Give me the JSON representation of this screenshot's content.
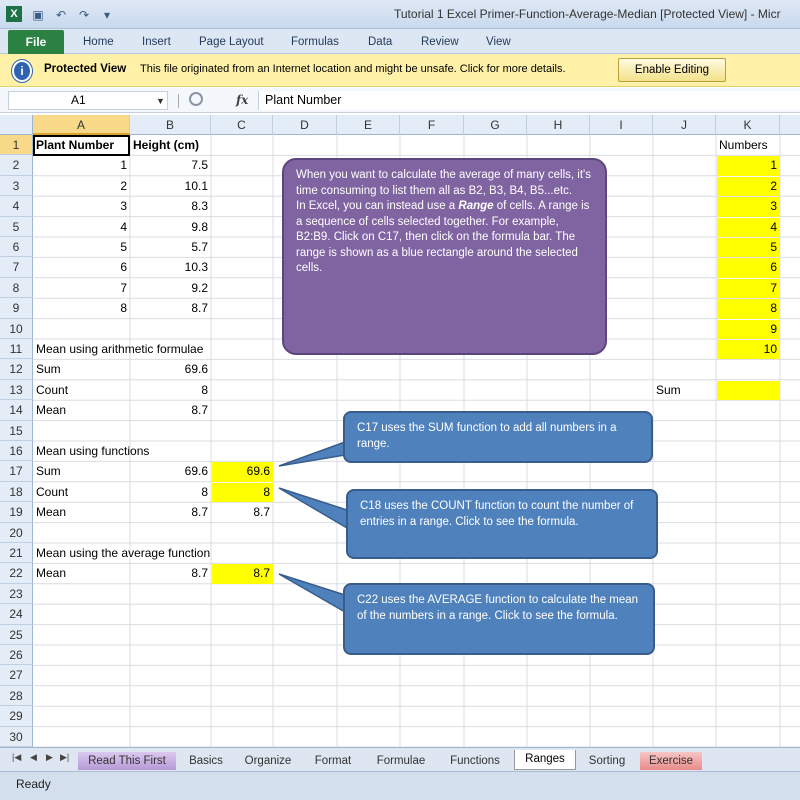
{
  "window": {
    "title": "Tutorial 1 Excel Primer-Function-Average-Median  [Protected View] - Micr",
    "app_icon": "excel-icon",
    "quick_access": [
      "save-icon",
      "undo-icon",
      "redo-icon",
      "customize-icon"
    ]
  },
  "ribbon": {
    "file_label": "File",
    "tabs": [
      "Home",
      "Insert",
      "Page Layout",
      "Formulas",
      "Data",
      "Review",
      "View"
    ]
  },
  "protected_view": {
    "title": "Protected View",
    "message": "This file originated from an Internet location and might be unsafe. Click for more details.",
    "button": "Enable Editing"
  },
  "formula_bar": {
    "name_box": "A1",
    "fx": "fx",
    "content": "Plant Number"
  },
  "columns": [
    "A",
    "B",
    "C",
    "D",
    "E",
    "F",
    "G",
    "H",
    "I",
    "J",
    "K"
  ],
  "rows": [
    "1",
    "2",
    "3",
    "4",
    "5",
    "6",
    "7",
    "8",
    "9",
    "10",
    "11",
    "12",
    "13",
    "14",
    "15",
    "16",
    "17",
    "18",
    "19",
    "20",
    "21",
    "22",
    "23",
    "24",
    "25",
    "26",
    "27",
    "28",
    "29",
    "30"
  ],
  "cells": {
    "A1": "Plant Number",
    "B1": "Height (cm)",
    "K1": "Numbers",
    "A2": "1",
    "B2": "7.5",
    "K2": "1",
    "A3": "2",
    "B3": "10.1",
    "K3": "2",
    "A4": "3",
    "B4": "8.3",
    "K4": "3",
    "A5": "4",
    "B5": "9.8",
    "K5": "4",
    "A6": "5",
    "B6": "5.7",
    "K6": "5",
    "A7": "6",
    "B7": "10.3",
    "K7": "6",
    "A8": "7",
    "B8": "9.2",
    "K8": "7",
    "A9": "8",
    "B9": "8.7",
    "K9": "8",
    "K10": "9",
    "A11": "Mean using arithmetic formulae",
    "K11": "10",
    "A12": "Sum",
    "B12": "69.6",
    "A13": "Count",
    "B13": "8",
    "J13": "Sum",
    "A14": "Mean",
    "B14": "8.7",
    "A16": "Mean using functions",
    "A17": "Sum",
    "B17": "69.6",
    "C17": "69.6",
    "A18": "Count",
    "B18": "8",
    "C18": "8",
    "A19": "Mean",
    "B19": "8.7",
    "C19": "8.7",
    "A21": "Mean using the average function",
    "A22": "Mean",
    "B22": "8.7",
    "C22": "8.7"
  },
  "callouts": {
    "range_note": {
      "p1": "When you want to calculate the average of many cells, it's time consuming to list them all as B2, B3, B4, B5...etc.",
      "p2_before": "In Excel, you can instead use a ",
      "p2_em": "Range",
      "p2_after": " of cells. A range is a sequence of cells selected together. For example, B2:B9. Click on C17, then click on the formula bar. The range is shown as a blue rectangle around the selected cells."
    },
    "sum_note": "C17 uses the SUM function to add all numbers in a range.",
    "count_note": "C18 uses the COUNT function to count the number of entries in a range. Click to see the formula.",
    "average_note": "C22 uses the AVERAGE function to calculate the mean of the numbers in a range. Click to see the formula."
  },
  "sheets": [
    "Read This First",
    "Basics",
    "Organize",
    "Format",
    "Formulae",
    "Functions",
    "Ranges",
    "Sorting",
    "Exercise"
  ],
  "active_sheet": "Ranges",
  "status": "Ready",
  "colors": {
    "highlight": "#ffff00",
    "callout_purple": "#8064a2",
    "callout_blue": "#4f81bd",
    "file_tab": "#2a8141"
  }
}
